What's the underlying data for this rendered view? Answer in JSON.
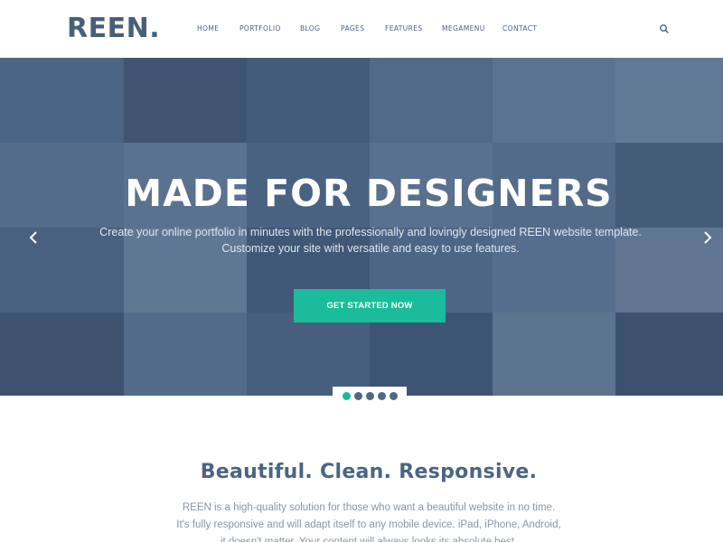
{
  "header": {
    "logo": "REEN.",
    "nav": [
      "HOME",
      "PORTFOLIO",
      "BLOG",
      "PAGES",
      "FEATURES",
      "MEGAMENU",
      "CONTACT"
    ],
    "search_icon": "search-icon"
  },
  "hero": {
    "title": "MADE FOR DESIGNERS",
    "subtitle_line1": "Create your online portfolio in minutes with the professionally and lovingly designed REEN website template.",
    "subtitle_line2": "Customize your site with versatile and easy to use features.",
    "cta_label": "GET STARTED NOW",
    "slide_count": 5,
    "active_slide": 1,
    "prev_icon": "chevron-left-icon",
    "next_icon": "chevron-right-icon",
    "overlay_color": "#3e5a7e",
    "accent_color": "#1abc9c"
  },
  "intro": {
    "title": "Beautiful. Clean. Responsive.",
    "line1": "REEN is a high-quality solution for those who want a beautiful website in no time.",
    "line2": "It's fully responsive and will adapt itself to any mobile device. iPad, iPhone, Android,",
    "line3": "it doesn't matter. Your content will always looks its absolute best."
  }
}
